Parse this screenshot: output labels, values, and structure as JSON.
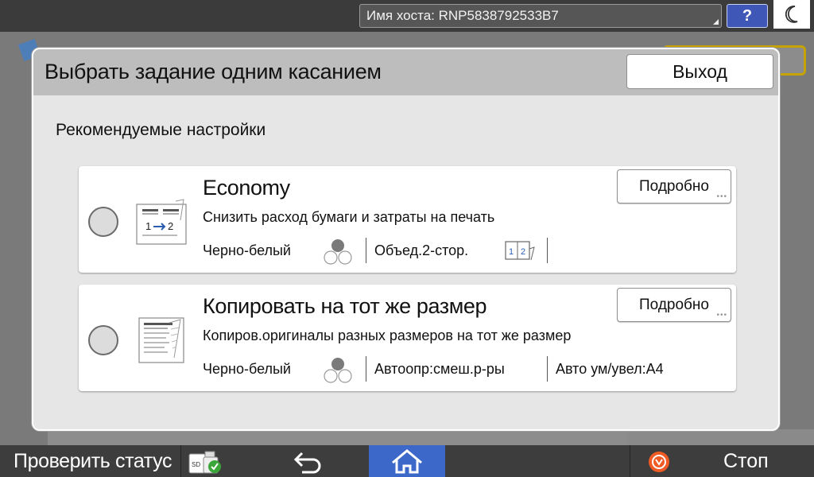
{
  "topbar": {
    "hostname": "Имя хоста: RNP5838792533B7",
    "help_label": "?"
  },
  "dialog": {
    "title": "Выбрать задание одним касанием",
    "exit_label": "Выход",
    "section_title": "Рекомендуемые настройки",
    "cards": [
      {
        "title": "Economy",
        "description": "Снизить расход бумаги и затраты на печать",
        "detail_label": "Подробно",
        "selected": false,
        "settings": [
          "Черно-белый",
          "Объед.2-стор."
        ],
        "duplex_icon_label": "1 2"
      },
      {
        "title": "Копировать на тот же размер",
        "description": "Копиров.оригиналы разных размеров на тот же размер",
        "detail_label": "Подробно",
        "selected": false,
        "settings": [
          "Черно-белый",
          "Автоопр:смеш.р-ры",
          "Авто ум/увел:A4"
        ]
      }
    ]
  },
  "bottombar": {
    "status_label": "Проверить статус",
    "stop_label": "Стоп",
    "sd_badge": "SD"
  },
  "colors": {
    "accent_blue": "#3c68c9",
    "help_blue": "#3f57b6",
    "stop_orange": "#f05a24",
    "header_gray": "#bdbdbd"
  }
}
